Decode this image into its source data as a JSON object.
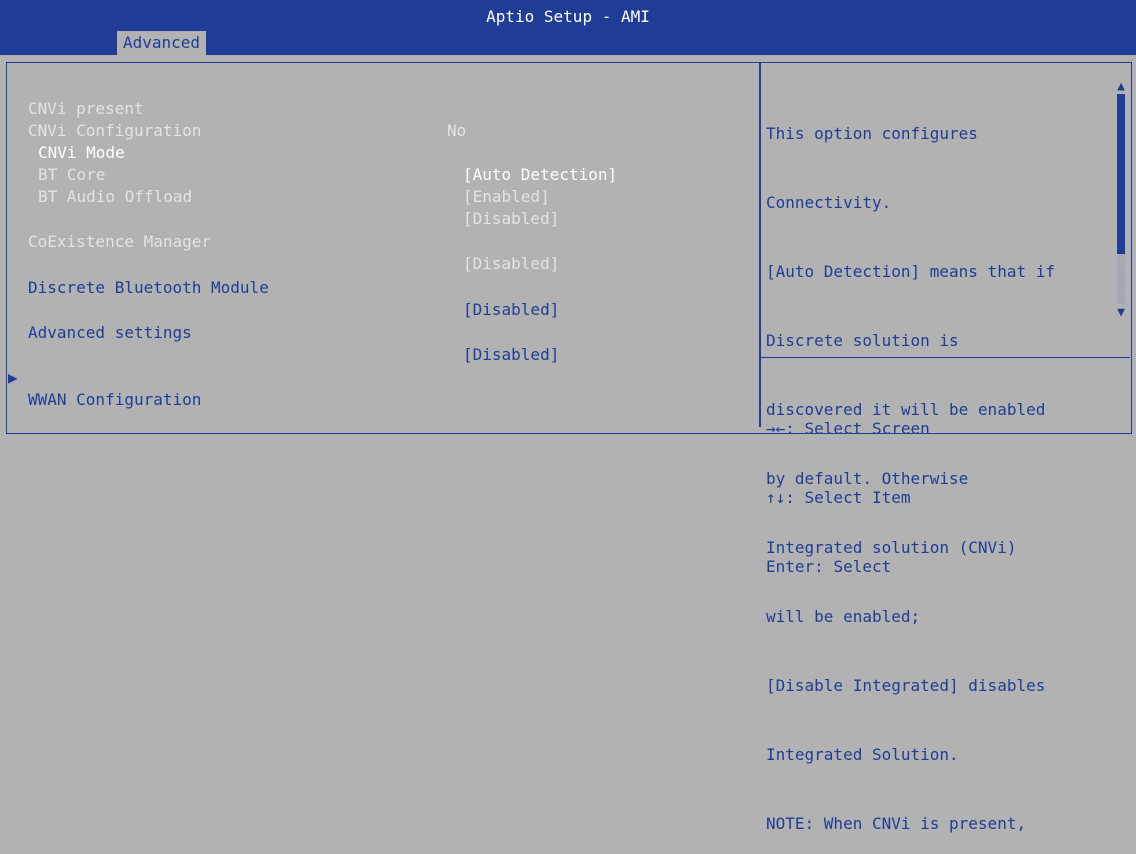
{
  "header": {
    "title": "Aptio Setup - AMI",
    "tabs": [
      {
        "label": "Advanced"
      }
    ]
  },
  "settings": [
    {
      "label": "CNVi present",
      "value": "No"
    },
    {
      "label": "CNVi Configuration",
      "value": ""
    },
    {
      "label": "CNVi Mode",
      "value": "[Auto Detection]"
    },
    {
      "label": "BT Core",
      "value": "[Enabled]"
    },
    {
      "label": "BT Audio Offload",
      "value": "[Disabled]"
    },
    {
      "label": "CoExistence Manager",
      "value": "[Disabled]"
    },
    {
      "label": "Discrete Bluetooth Module",
      "value": "[Disabled]"
    },
    {
      "label": "Advanced settings",
      "value": "[Disabled]"
    },
    {
      "label": "WWAN Configuration",
      "value": "",
      "submenu_arrow": "▶"
    }
  ],
  "help": {
    "lines": [
      "This option configures",
      "Connectivity.",
      "[Auto Detection] means that if",
      "Discrete solution is",
      "discovered it will be enabled",
      "by default. Otherwise",
      "Integrated solution (CNVi)",
      "will be enabled;",
      "[Disable Integrated] disables",
      "Integrated Solution.",
      "NOTE: When CNVi is present,"
    ],
    "scroll_up_icon": "▲",
    "scroll_down_icon": "▼"
  },
  "keys": [
    {
      "key": "→←",
      "action": ": Select Screen"
    },
    {
      "key": "↑↓",
      "action": ": Select Item"
    },
    {
      "key": "Enter",
      "action": ": Select"
    }
  ],
  "colors": {
    "background": "#b2b2b2",
    "accent": "#1f3d96",
    "highlight_text": "#ffffff"
  }
}
